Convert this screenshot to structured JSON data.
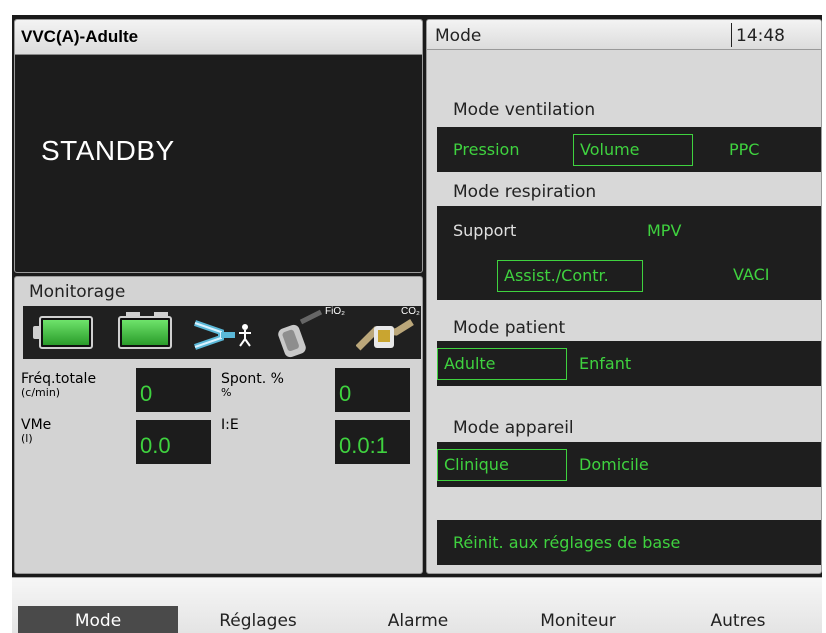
{
  "status": {
    "header": "VVC(A)-Adulte",
    "state": "STANDBY"
  },
  "monitor": {
    "header": "Monitorage",
    "icons": {
      "fio2_label": "FiO₂",
      "co2_label": "CO₂"
    },
    "fields": [
      {
        "label": "Fréq.totale",
        "unit": "(c/min)",
        "value": "0"
      },
      {
        "label": "Spont. %",
        "unit": "%",
        "value": "0"
      },
      {
        "label": "VMe",
        "unit": "(l)",
        "value": "0.0"
      },
      {
        "label": "I:E",
        "unit": "",
        "value": "0.0:1"
      }
    ]
  },
  "mode": {
    "header": "Mode",
    "clock": "14:48",
    "ventilation": {
      "title": "Mode ventilation",
      "options": [
        "Pression",
        "Volume",
        "PPC"
      ],
      "selected": "Volume"
    },
    "respiration": {
      "title": "Mode respiration",
      "options": [
        "Support",
        "MPV",
        "Assist./Contr.",
        "VACI"
      ],
      "selected": "Assist./Contr."
    },
    "patient": {
      "title": "Mode patient",
      "options": [
        "Adulte",
        "Enfant"
      ],
      "selected": "Adulte"
    },
    "device": {
      "title": "Mode appareil",
      "options": [
        "Clinique",
        "Domicile"
      ],
      "selected": "Clinique"
    },
    "reset_label": "Réinit. aux réglages de base"
  },
  "nav": {
    "items": [
      "Mode",
      "Réglages",
      "Alarme",
      "Moniteur",
      "Autres"
    ],
    "active": "Mode"
  },
  "colors": {
    "accent_green": "#3fd23f",
    "panel_dark": "#1e1e1e",
    "panel_light": "#d8d8d8"
  }
}
